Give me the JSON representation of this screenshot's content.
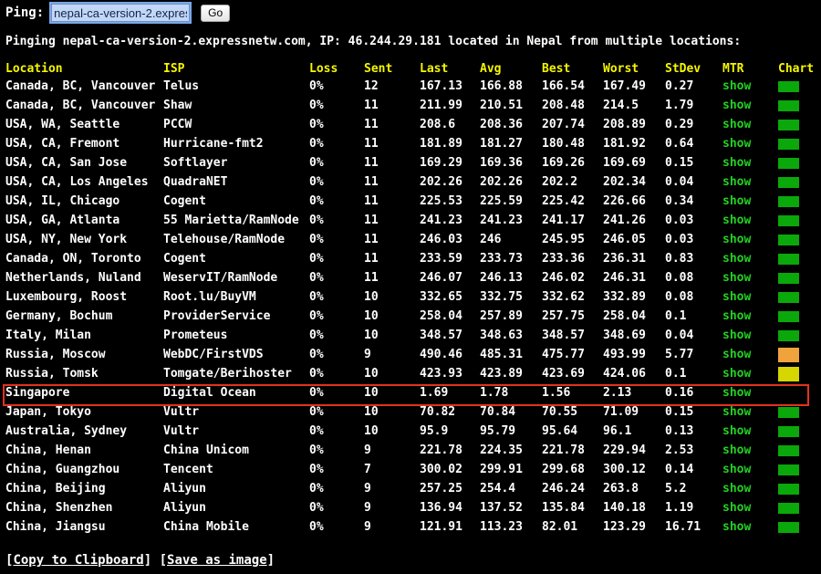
{
  "header": {
    "ping_label": "Ping:",
    "host_value": "nepal-ca-version-2.expressnetw.com",
    "go_label": "Go"
  },
  "summary": {
    "prefix": "Pinging nepal-ca-version-2.expressnetw.com, IP: 46.244.29.181 located in ",
    "country": "Nepal",
    "suffix": " from multiple locations:"
  },
  "columns": {
    "location": "Location",
    "isp": "ISP",
    "loss": "Loss",
    "sent": "Sent",
    "last": "Last",
    "avg": "Avg",
    "best": "Best",
    "worst": "Worst",
    "stdev": "StDev",
    "mtr": "MTR",
    "chart": "Chart"
  },
  "colors": {
    "header": "#f6f600",
    "link": "#22d122",
    "highlight_border": "#e3321e",
    "bar_green": "#0aa80a",
    "bar_orange": "#f0a33c",
    "bar_yellow": "#d6d600"
  },
  "rows": [
    {
      "location": "Canada, BC, Vancouver",
      "isp": "Telus",
      "loss": "0%",
      "sent": "12",
      "last": "167.13",
      "avg": "166.88",
      "best": "166.54",
      "worst": "167.49",
      "stdev": "0.27",
      "mtr": "show",
      "chart": "green"
    },
    {
      "location": "Canada, BC, Vancouver",
      "isp": "Shaw",
      "loss": "0%",
      "sent": "11",
      "last": "211.99",
      "avg": "210.51",
      "best": "208.48",
      "worst": "214.5",
      "stdev": "1.79",
      "mtr": "show",
      "chart": "green"
    },
    {
      "location": "USA, WA, Seattle",
      "isp": "PCCW",
      "loss": "0%",
      "sent": "11",
      "last": "208.6",
      "avg": "208.36",
      "best": "207.74",
      "worst": "208.89",
      "stdev": "0.29",
      "mtr": "show",
      "chart": "green"
    },
    {
      "location": "USA, CA, Fremont",
      "isp": "Hurricane-fmt2",
      "loss": "0%",
      "sent": "11",
      "last": "181.89",
      "avg": "181.27",
      "best": "180.48",
      "worst": "181.92",
      "stdev": "0.64",
      "mtr": "show",
      "chart": "green"
    },
    {
      "location": "USA, CA, San Jose",
      "isp": "Softlayer",
      "loss": "0%",
      "sent": "11",
      "last": "169.29",
      "avg": "169.36",
      "best": "169.26",
      "worst": "169.69",
      "stdev": "0.15",
      "mtr": "show",
      "chart": "green"
    },
    {
      "location": "USA, CA, Los Angeles",
      "isp": "QuadraNET",
      "loss": "0%",
      "sent": "11",
      "last": "202.26",
      "avg": "202.26",
      "best": "202.2",
      "worst": "202.34",
      "stdev": "0.04",
      "mtr": "show",
      "chart": "green"
    },
    {
      "location": "USA, IL, Chicago",
      "isp": "Cogent",
      "loss": "0%",
      "sent": "11",
      "last": "225.53",
      "avg": "225.59",
      "best": "225.42",
      "worst": "226.66",
      "stdev": "0.34",
      "mtr": "show",
      "chart": "green"
    },
    {
      "location": "USA, GA, Atlanta",
      "isp": "55 Marietta/RamNode",
      "loss": "0%",
      "sent": "11",
      "last": "241.23",
      "avg": "241.23",
      "best": "241.17",
      "worst": "241.26",
      "stdev": "0.03",
      "mtr": "show",
      "chart": "green"
    },
    {
      "location": "USA, NY, New York",
      "isp": "Telehouse/RamNode",
      "loss": "0%",
      "sent": "11",
      "last": "246.03",
      "avg": "246",
      "best": "245.95",
      "worst": "246.05",
      "stdev": "0.03",
      "mtr": "show",
      "chart": "green"
    },
    {
      "location": "Canada, ON, Toronto",
      "isp": "Cogent",
      "loss": "0%",
      "sent": "11",
      "last": "233.59",
      "avg": "233.73",
      "best": "233.36",
      "worst": "236.31",
      "stdev": "0.83",
      "mtr": "show",
      "chart": "green"
    },
    {
      "location": "Netherlands, Nuland",
      "isp": "WeservIT/RamNode",
      "loss": "0%",
      "sent": "11",
      "last": "246.07",
      "avg": "246.13",
      "best": "246.02",
      "worst": "246.31",
      "stdev": "0.08",
      "mtr": "show",
      "chart": "green"
    },
    {
      "location": "Luxembourg, Roost",
      "isp": "Root.lu/BuyVM",
      "loss": "0%",
      "sent": "10",
      "last": "332.65",
      "avg": "332.75",
      "best": "332.62",
      "worst": "332.89",
      "stdev": "0.08",
      "mtr": "show",
      "chart": "green"
    },
    {
      "location": "Germany, Bochum",
      "isp": "ProviderService",
      "loss": "0%",
      "sent": "10",
      "last": "258.04",
      "avg": "257.89",
      "best": "257.75",
      "worst": "258.04",
      "stdev": "0.1",
      "mtr": "show",
      "chart": "green"
    },
    {
      "location": "Italy, Milan",
      "isp": "Prometeus",
      "loss": "0%",
      "sent": "10",
      "last": "348.57",
      "avg": "348.63",
      "best": "348.57",
      "worst": "348.69",
      "stdev": "0.04",
      "mtr": "show",
      "chart": "green"
    },
    {
      "location": "Russia, Moscow",
      "isp": "WebDC/FirstVDS",
      "loss": "0%",
      "sent": "9",
      "last": "490.46",
      "avg": "485.31",
      "best": "475.77",
      "worst": "493.99",
      "stdev": "5.77",
      "mtr": "show",
      "chart": "orange"
    },
    {
      "location": "Russia, Tomsk",
      "isp": "Tomgate/Berihoster",
      "loss": "0%",
      "sent": "10",
      "last": "423.93",
      "avg": "423.89",
      "best": "423.69",
      "worst": "424.06",
      "stdev": "0.1",
      "mtr": "show",
      "chart": "yellow"
    },
    {
      "location": "Singapore",
      "isp": "Digital Ocean",
      "loss": "0%",
      "sent": "10",
      "last": "1.69",
      "avg": "1.78",
      "best": "1.56",
      "worst": "2.13",
      "stdev": "0.16",
      "mtr": "show",
      "chart": "none",
      "highlighted": true
    },
    {
      "location": "Japan, Tokyo",
      "isp": "Vultr",
      "loss": "0%",
      "sent": "10",
      "last": "70.82",
      "avg": "70.84",
      "best": "70.55",
      "worst": "71.09",
      "stdev": "0.15",
      "mtr": "show",
      "chart": "green"
    },
    {
      "location": "Australia, Sydney",
      "isp": "Vultr",
      "loss": "0%",
      "sent": "10",
      "last": "95.9",
      "avg": "95.79",
      "best": "95.64",
      "worst": "96.1",
      "stdev": "0.13",
      "mtr": "show",
      "chart": "green"
    },
    {
      "location": "China, Henan",
      "isp": "China Unicom",
      "loss": "0%",
      "sent": "9",
      "last": "221.78",
      "avg": "224.35",
      "best": "221.78",
      "worst": "229.94",
      "stdev": "2.53",
      "mtr": "show",
      "chart": "green"
    },
    {
      "location": "China, Guangzhou",
      "isp": "Tencent",
      "loss": "0%",
      "sent": "7",
      "last": "300.02",
      "avg": "299.91",
      "best": "299.68",
      "worst": "300.12",
      "stdev": "0.14",
      "mtr": "show",
      "chart": "green"
    },
    {
      "location": "China, Beijing",
      "isp": "Aliyun",
      "loss": "0%",
      "sent": "9",
      "last": "257.25",
      "avg": "254.4",
      "best": "246.24",
      "worst": "263.8",
      "stdev": "5.2",
      "mtr": "show",
      "chart": "green"
    },
    {
      "location": "China, Shenzhen",
      "isp": "Aliyun",
      "loss": "0%",
      "sent": "9",
      "last": "136.94",
      "avg": "137.52",
      "best": "135.84",
      "worst": "140.18",
      "stdev": "1.19",
      "mtr": "show",
      "chart": "green"
    },
    {
      "location": "China, Jiangsu",
      "isp": "China Mobile",
      "loss": "0%",
      "sent": "9",
      "last": "121.91",
      "avg": "113.23",
      "best": "82.01",
      "worst": "123.29",
      "stdev": "16.71",
      "mtr": "show",
      "chart": "green"
    }
  ],
  "footer": {
    "copy_label": "Copy to Clipboard",
    "save_label": "Save as image"
  }
}
